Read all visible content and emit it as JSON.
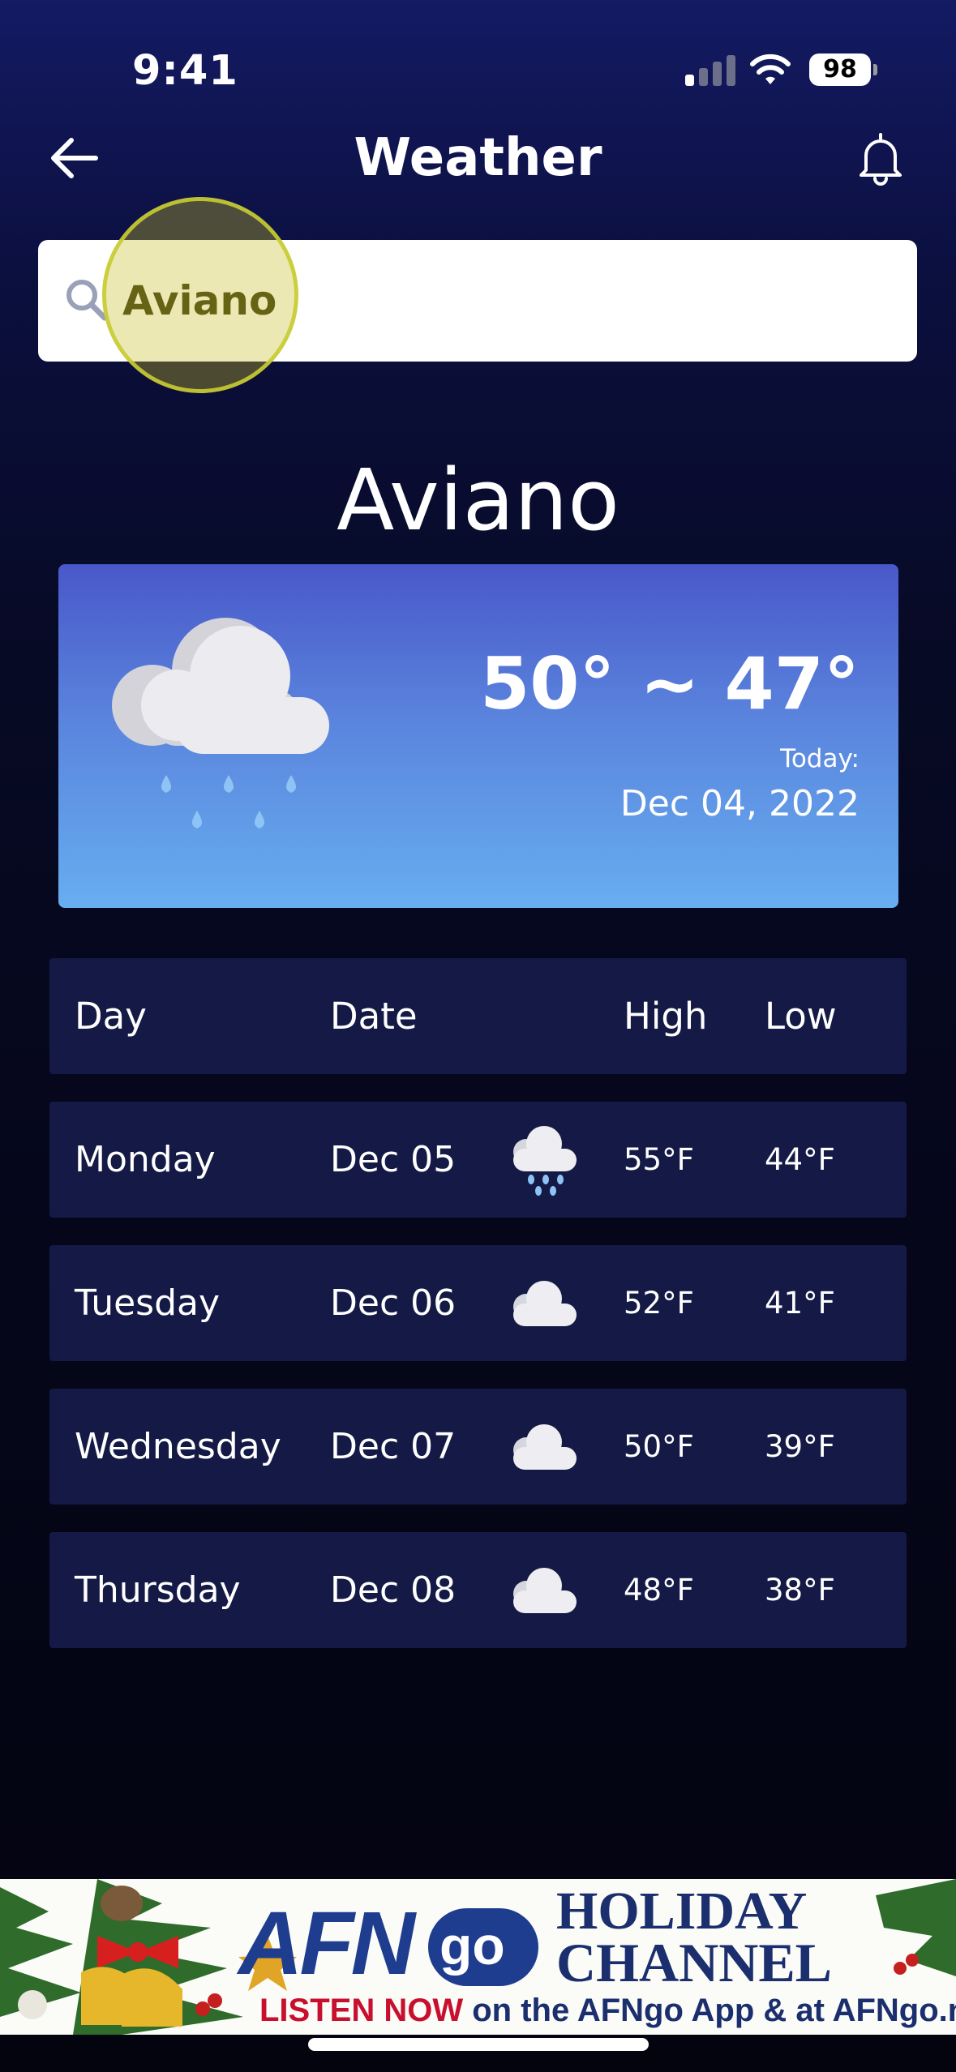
{
  "status_bar": {
    "time": "9:41",
    "battery": "98"
  },
  "header": {
    "title": "Weather",
    "back_icon": "arrow-left-icon",
    "notification_icon": "bell-icon"
  },
  "search": {
    "value": "Aviano",
    "icon": "search-icon"
  },
  "city": "Aviano",
  "today_card": {
    "icon": "rain-cloud-icon",
    "temperature_range": "50° ~ 47°",
    "today_label": "Today:",
    "date": "Dec 04, 2022"
  },
  "forecast": {
    "headers": {
      "day": "Day",
      "date": "Date",
      "high": "High",
      "low": "Low"
    },
    "rows": [
      {
        "day": "Monday",
        "date": "Dec 05",
        "icon": "rain-cloud-icon",
        "high": "55°F",
        "low": "44°F"
      },
      {
        "day": "Tuesday",
        "date": "Dec 06",
        "icon": "cloud-icon",
        "high": "52°F",
        "low": "41°F"
      },
      {
        "day": "Wednesday",
        "date": "Dec 07",
        "icon": "cloud-icon",
        "high": "50°F",
        "low": "39°F"
      },
      {
        "day": "Thursday",
        "date": "Dec 08",
        "icon": "cloud-icon",
        "high": "48°F",
        "low": "38°F"
      }
    ]
  },
  "banner": {
    "brand": "AFN",
    "brand_go": "go",
    "line1": "HOLIDAY",
    "line2": "CHANNEL",
    "cta": "LISTEN NOW",
    "cta_rest": " on the AFNgo App & at AFNgo.net"
  },
  "colors": {
    "card_top": "#4958c9",
    "card_bottom": "#67aef0",
    "row_bg": "#141a45",
    "banner_blue": "#1e3d8f",
    "banner_red": "#c8102e"
  }
}
